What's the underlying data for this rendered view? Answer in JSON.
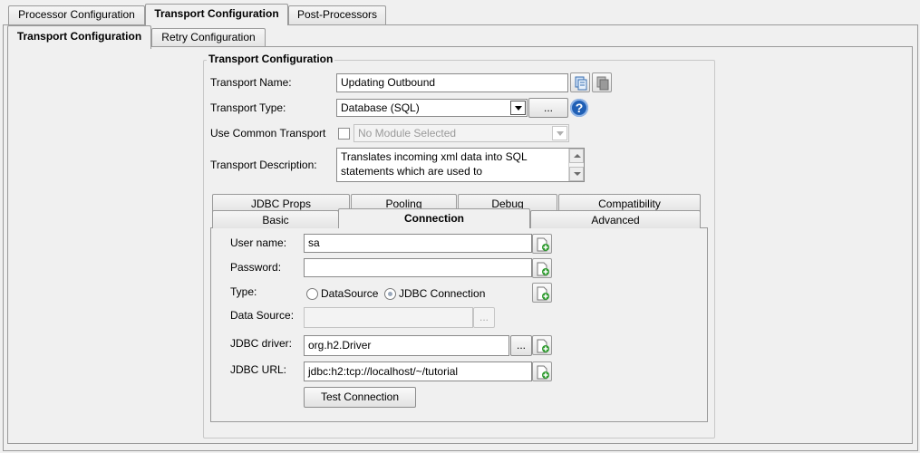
{
  "top_tabs": [
    "Processor Configuration",
    "Transport Configuration",
    "Post-Processors"
  ],
  "sub_tabs": [
    "Transport Configuration",
    "Retry Configuration"
  ],
  "group_title": "Transport Configuration",
  "transport": {
    "name_label": "Transport Name:",
    "name_value": "Updating Outbound",
    "type_label": "Transport Type:",
    "type_value": "Database (SQL)",
    "browse_label": "...",
    "help_glyph": "?",
    "common_label": "Use Common Transport",
    "module_value": "No Module Selected",
    "desc_label": "Transport Description:",
    "desc_line1": "Translates incoming xml data into SQL",
    "desc_line2": "statements which are used to"
  },
  "inner_tabs": {
    "row1": [
      "JDBC Props",
      "Pooling",
      "Debug",
      "Compatibility"
    ],
    "row2": [
      "Basic",
      "Connection",
      "Advanced"
    ]
  },
  "connection": {
    "user_label": "User name:",
    "user_value": "sa",
    "password_label": "Password:",
    "password_value": "",
    "type_label": "Type:",
    "radio_datasource": "DataSource",
    "radio_jdbc": "JDBC Connection",
    "ds_label": "Data Source:",
    "ds_value": "",
    "ds_browse": "...",
    "driver_label": "JDBC driver:",
    "driver_value": "org.h2.Driver",
    "driver_browse": "...",
    "url_label": "JDBC URL:",
    "url_value": "jdbc:h2:tcp://localhost/~/tutorial",
    "test_button": "Test Connection"
  },
  "icons": {
    "copy": "copy-icon",
    "paste": "paste-icon",
    "variable": "add-variable-icon",
    "help": "help-icon"
  },
  "colors": {
    "background": "#f0f0f0",
    "help_blue": "#1f5fb5",
    "variable_green": "#2e9b2e"
  }
}
